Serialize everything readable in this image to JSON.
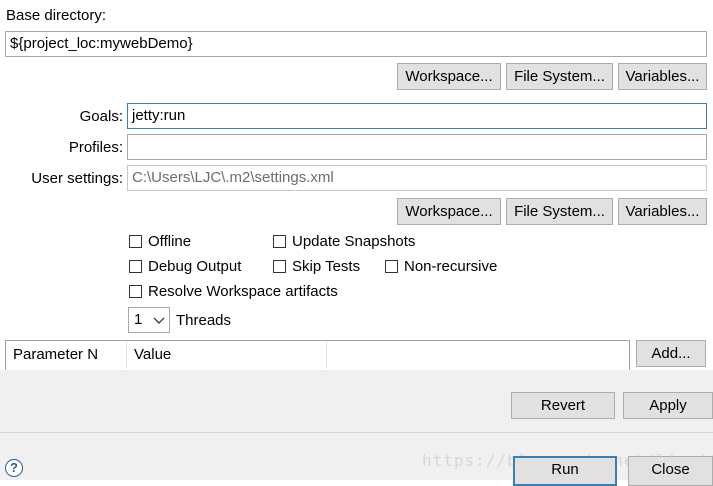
{
  "base_directory": {
    "label": "Base directory:",
    "value": "${project_loc:mywebDemo}",
    "buttons": {
      "workspace": "Workspace...",
      "file_system": "File System...",
      "variables": "Variables..."
    }
  },
  "goals": {
    "label": "Goals:",
    "value": "jetty:run"
  },
  "profiles": {
    "label": "Profiles:",
    "value": ""
  },
  "user_settings": {
    "label": "User settings:",
    "value": "C:\\Users\\LJC\\.m2\\settings.xml",
    "buttons": {
      "workspace": "Workspace...",
      "file_system": "File System...",
      "variables": "Variables..."
    }
  },
  "options": {
    "offline": {
      "label": "Offline",
      "checked": false
    },
    "update_snapshots": {
      "label": "Update Snapshots",
      "checked": false
    },
    "debug_output": {
      "label": "Debug Output",
      "checked": false
    },
    "skip_tests": {
      "label": "Skip Tests",
      "checked": false
    },
    "non_recursive": {
      "label": "Non-recursive",
      "checked": false
    },
    "resolve_workspace": {
      "label": "Resolve Workspace artifacts",
      "checked": false
    }
  },
  "threads": {
    "value": "1",
    "label": "Threads"
  },
  "parameters_table": {
    "columns": [
      "Parameter N",
      "Value"
    ],
    "add_label": "Add..."
  },
  "actions": {
    "revert": "Revert",
    "apply": "Apply"
  },
  "dialog": {
    "run": "Run",
    "close": "Close",
    "help_glyph": "?"
  },
  "watermark": "https://blog.csdn.net/ljcgit",
  "colors": {
    "focus_border": "#3c7fb1",
    "button_bg": "#e1e1e1",
    "help_blue": "#2a5f98"
  }
}
